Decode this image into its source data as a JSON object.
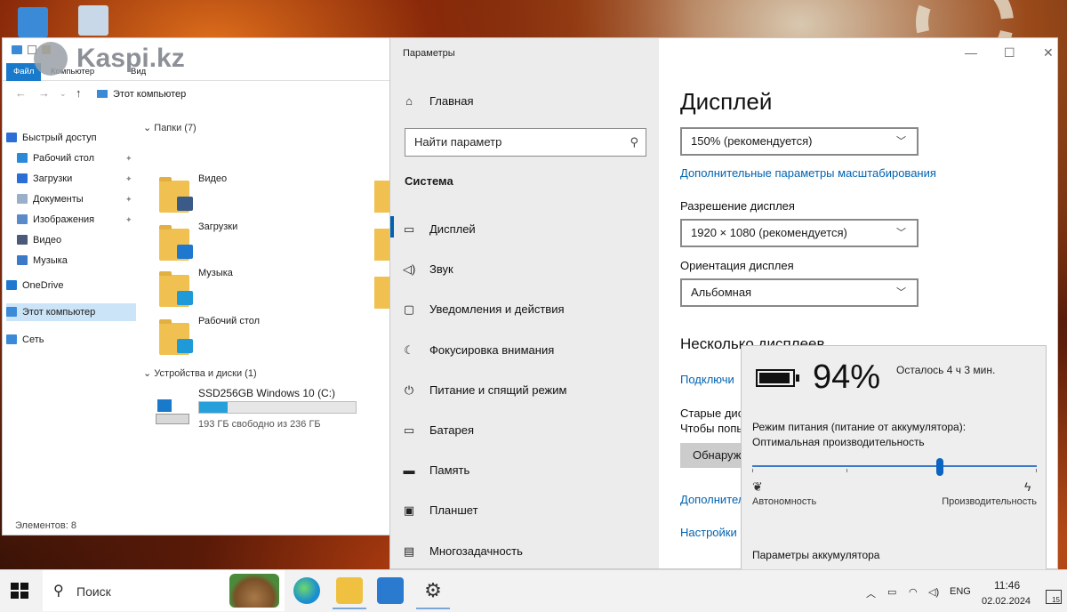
{
  "watermark": {
    "text": "Kaspi.kz"
  },
  "explorer": {
    "ribbon_tabs": [
      "Файл",
      "Компьютер",
      "Вид"
    ],
    "address": "Этот компьютер",
    "nav": [
      {
        "label": "Быстрый доступ",
        "icon": "star-icon",
        "color": "#2b6fd6",
        "pinned": false
      },
      {
        "label": "Рабочий стол",
        "icon": "desktop-icon",
        "color": "#2b8ad8",
        "pinned": true
      },
      {
        "label": "Загрузки",
        "icon": "download-icon",
        "color": "#2b6fd6",
        "pinned": true
      },
      {
        "label": "Документы",
        "icon": "document-icon",
        "color": "#9ab0c8",
        "pinned": true
      },
      {
        "label": "Изображения",
        "icon": "image-icon",
        "color": "#5a8ac8",
        "pinned": true
      },
      {
        "label": "Видео",
        "icon": "video-icon",
        "color": "#4a5a78",
        "pinned": false
      },
      {
        "label": "Музыка",
        "icon": "music-icon",
        "color": "#3a7ac8",
        "pinned": false
      },
      {
        "label": "OneDrive",
        "icon": "cloud-icon",
        "color": "#1f78d0",
        "pinned": false
      },
      {
        "label": "Этот компьютер",
        "icon": "computer-icon",
        "color": "#3a8ad8",
        "pinned": false,
        "selected": true
      },
      {
        "label": "Сеть",
        "icon": "network-icon",
        "color": "#3a8ad8",
        "pinned": false
      }
    ],
    "folders_header": "Папки (7)",
    "folders": [
      {
        "name": "Видео",
        "badge_color": "#3a5a88"
      },
      {
        "name": "Загрузки",
        "badge_color": "#1f78d0"
      },
      {
        "name": "Музыка",
        "badge_color": "#1f9ad8"
      },
      {
        "name": "Рабочий стол",
        "badge_color": "#1f9ad8"
      }
    ],
    "drives_header": "Устройства и диски (1)",
    "drive": {
      "name": "SSD256GB Windows 10 (C:)",
      "free_text": "193 ГБ свободно из 236 ГБ",
      "used_fraction": 0.18
    },
    "status": "Элементов: 8"
  },
  "settings": {
    "window_title": "Параметры",
    "home": "Главная",
    "search_placeholder": "Найти параметр",
    "section": "Система",
    "nav": [
      {
        "label": "Дисплей",
        "icon": "display-icon",
        "glyph": "▭"
      },
      {
        "label": "Звук",
        "icon": "sound-icon",
        "glyph": "◁)"
      },
      {
        "label": "Уведомления и действия",
        "icon": "notifications-icon",
        "glyph": "▢"
      },
      {
        "label": "Фокусировка внимания",
        "icon": "moon-icon",
        "glyph": "☾"
      },
      {
        "label": "Питание и спящий режим",
        "icon": "power-icon",
        "glyph": "⏻"
      },
      {
        "label": "Батарея",
        "icon": "battery-icon",
        "glyph": "▭"
      },
      {
        "label": "Память",
        "icon": "storage-icon",
        "glyph": "▬"
      },
      {
        "label": "Планшет",
        "icon": "tablet-icon",
        "glyph": "▣"
      },
      {
        "label": "Многозадачность",
        "icon": "multitask-icon",
        "glyph": "▤"
      }
    ],
    "page_title": "Дисплей",
    "scale_value": "150% (рекомендуется)",
    "advanced_scaling": "Дополнительные параметры масштабирования",
    "resolution_label": "Разрешение дисплея",
    "resolution_value": "1920 × 1080 (рекомендуется)",
    "orientation_label": "Ориентация дисплея",
    "orientation_value": "Альбомная",
    "multi_header": "Несколько дисплеев",
    "connect_link": "Подключи",
    "old_displays_1": "Старые дис",
    "old_displays_2": "Чтобы попы",
    "detect_btn": "Обнаруж",
    "more_link": "Дополнител",
    "settings_link": "Настройки"
  },
  "battery": {
    "percent": "94%",
    "percent_value": 94,
    "remaining": "Осталось 4 ч 3 мин.",
    "mode_label": "Режим питания (питание от аккумулятора):",
    "mode_value": "Оптимальная производительность",
    "slider_fraction": 0.66,
    "min_label": "Автономность",
    "max_label": "Производительность",
    "settings_link": "Параметры аккумулятора"
  },
  "taskbar": {
    "search_placeholder": "Поиск",
    "apps": [
      {
        "name": "edge",
        "color": "#1a8fd0"
      },
      {
        "name": "explorer",
        "color": "#f0c040"
      },
      {
        "name": "store",
        "color": "#2a7ad0"
      },
      {
        "name": "settings",
        "color": "#333333"
      }
    ],
    "lang": "ENG",
    "time": "11:46",
    "date": "02.02.2024",
    "notifications": "15"
  }
}
